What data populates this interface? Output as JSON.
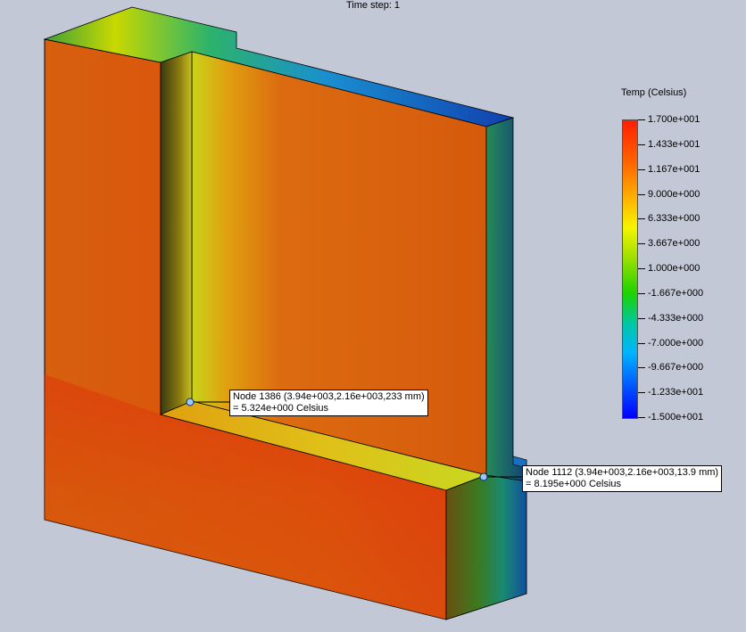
{
  "viewport": {
    "time_step_label": "Time step: 1"
  },
  "legend": {
    "title": "Temp (Celsius)",
    "labels": [
      "1.700e+001",
      "1.433e+001",
      "1.167e+001",
      "9.000e+000",
      "6.333e+000",
      "3.667e+000",
      "1.000e+000",
      "-1.667e+000",
      "-4.333e+000",
      "-7.000e+000",
      "-9.667e+000",
      "-1.233e+001",
      "-1.500e+001"
    ],
    "colors": {
      "max": "#ff1e00",
      "mid": "#f5f500",
      "min": "#0000ff"
    }
  },
  "probes": [
    {
      "header": "Node 1386 (3.94e+003,2.16e+003,233 mm)",
      "value": " = 5.324e+000 Celsius"
    },
    {
      "header": "Node 1112 (3.94e+003,2.16e+003,13.9 mm)",
      "value": " = 8.195e+000 Celsius"
    }
  ]
}
